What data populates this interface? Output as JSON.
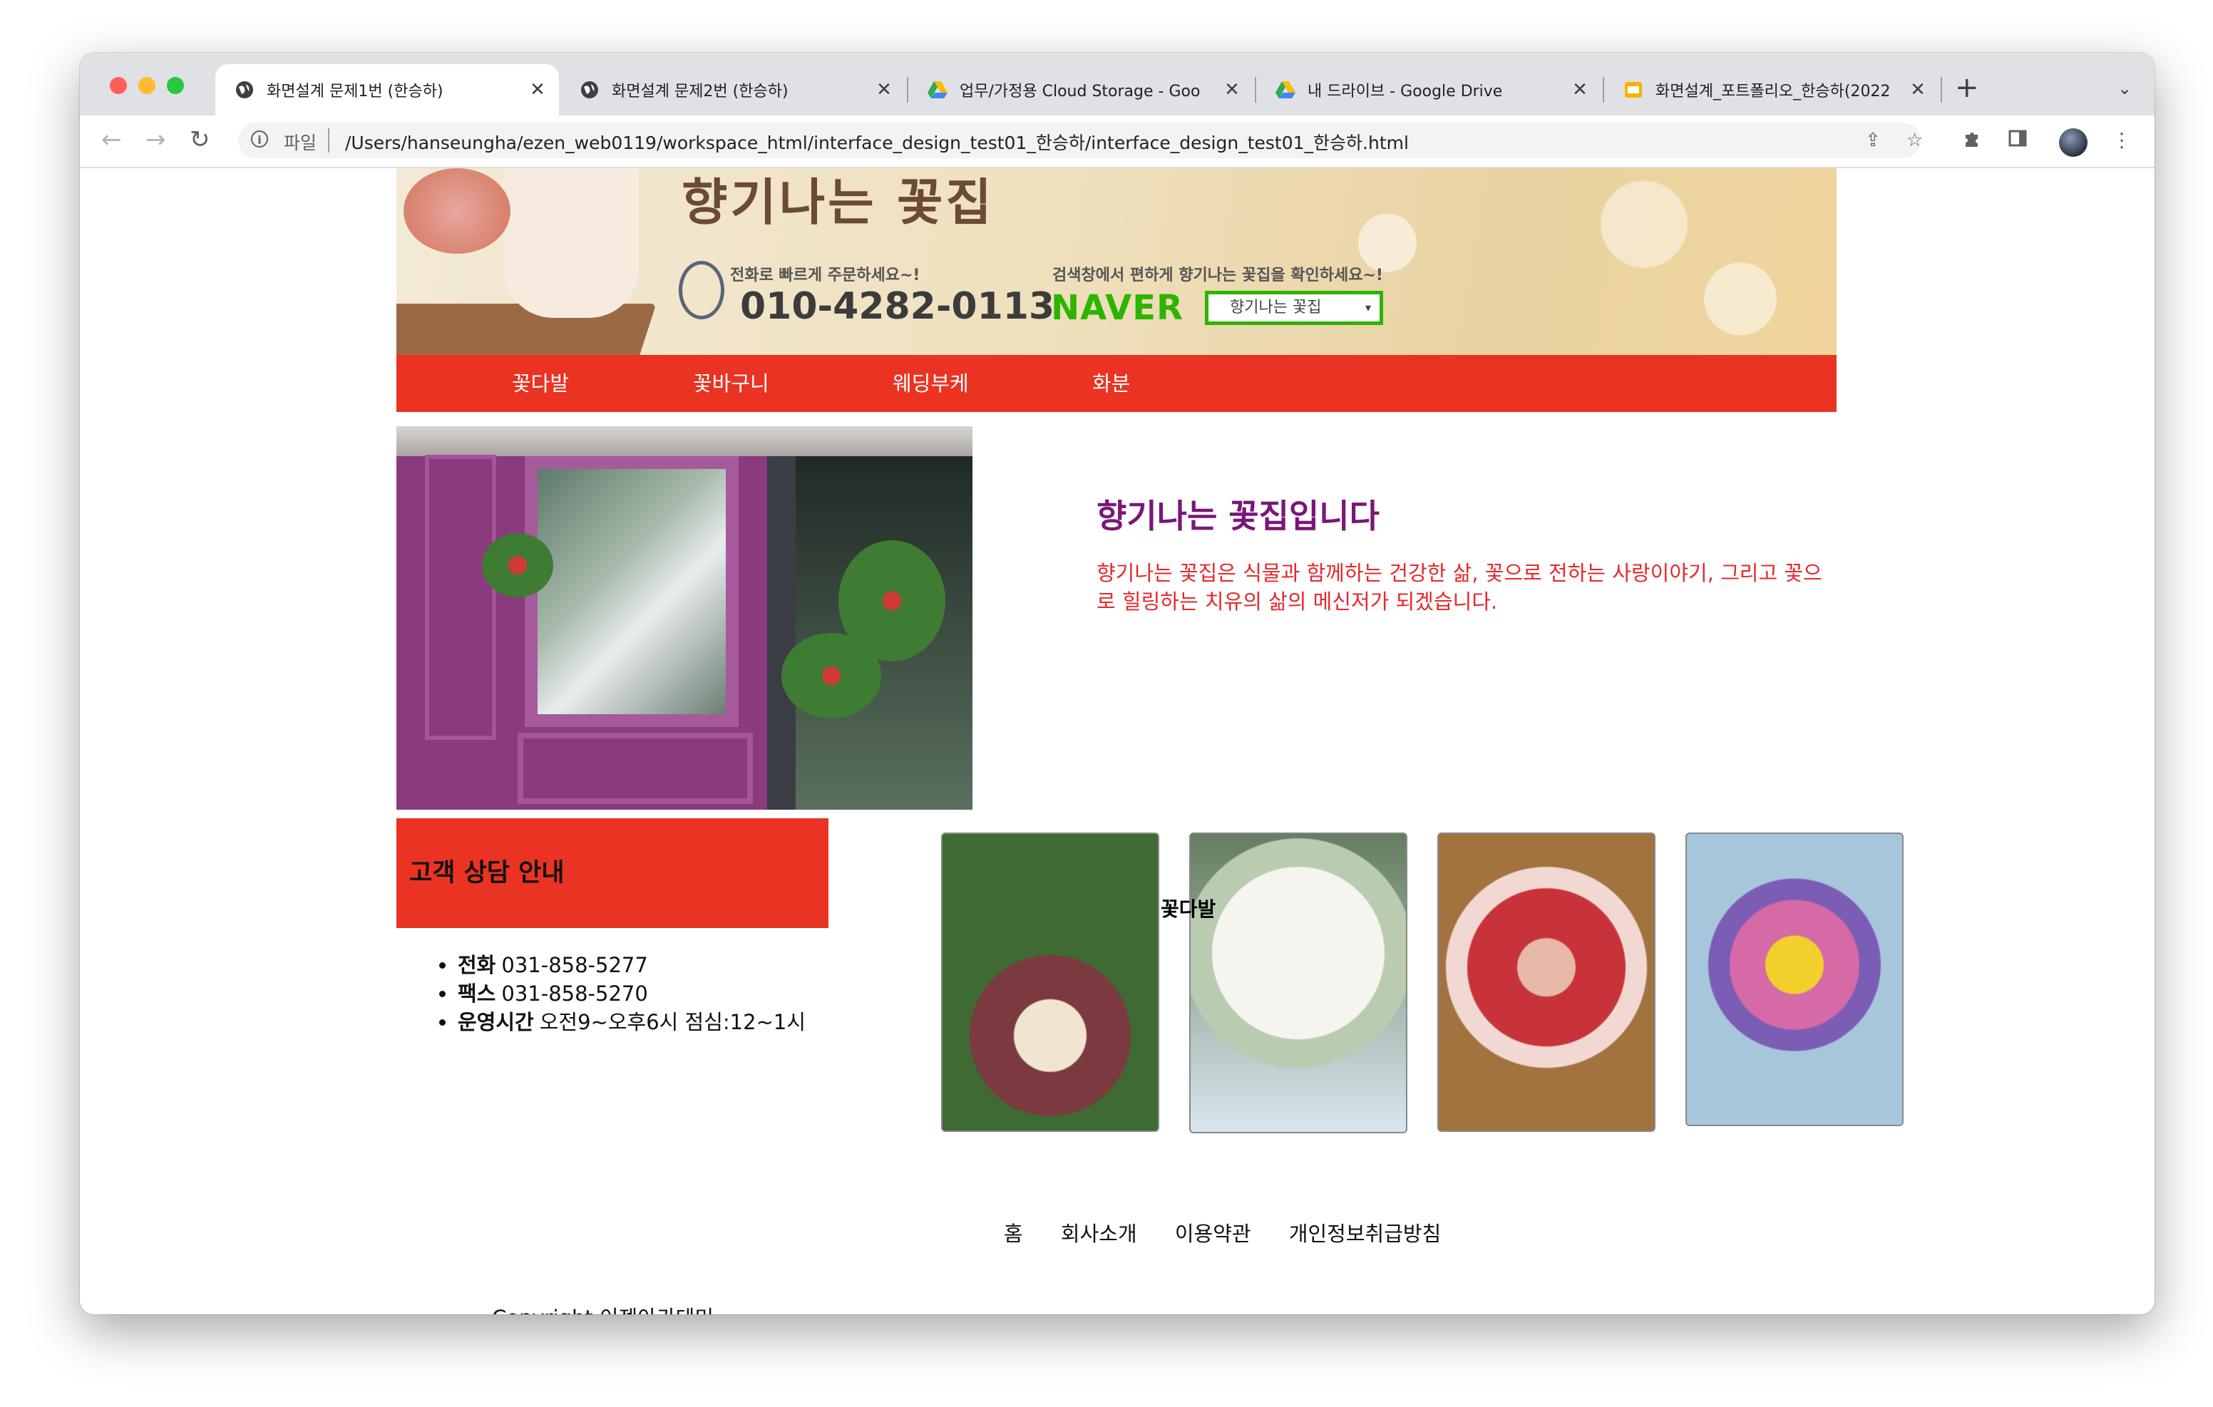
{
  "browser": {
    "tabs": [
      {
        "title": "화면설계 문제1번 (한승하)",
        "icon": "globe-icon"
      },
      {
        "title": "화면설계 문제2번 (한승하)",
        "icon": "globe-icon"
      },
      {
        "title": "업무/가정용 Cloud Storage - Goo",
        "icon": "google-drive-icon"
      },
      {
        "title": "내 드라이브 - Google Drive",
        "icon": "google-drive-icon"
      },
      {
        "title": "화면설계_포트폴리오_한승하(2022",
        "icon": "google-slides-icon"
      }
    ],
    "address": {
      "scheme_label": "파일",
      "url": "/Users/hanseungha/ezen_web0119/workspace_html/interface_design_test01_한승하/interface_design_test01_한승하.html"
    }
  },
  "header": {
    "logo_text": "향기나는 꽃집",
    "order_note": "전화로 빠르게 주문하세요~!",
    "phone": "010-4282-0113",
    "search_note": "검색창에서 편하게 향기나는 꽃집을 확인하세요~!",
    "naver_logo": "NAVER",
    "naver_search": "향기나는 꽃집"
  },
  "nav": {
    "items": [
      "꽃다발",
      "꽃바구니",
      "웨딩부케",
      "화분"
    ]
  },
  "intro": {
    "title": "향기나는 꽃집입니다",
    "text": "향기나는 꽃집은 식물과 함께하는 건강한 삶, 꽃으로 전하는 사랑이야기, 그리고 꽃으로 힐링하는 치유의 삶의 메신저가 되겠습니다."
  },
  "consult": {
    "title": "고객 상담 안내",
    "items": [
      {
        "label": "전화",
        "value": "031-858-5277"
      },
      {
        "label": "팩스",
        "value": "031-858-5270"
      },
      {
        "label": "운영시간",
        "value": "오전9~오후6시 점심:12~1시"
      }
    ]
  },
  "gallery": {
    "overlap_label": "꽃다발"
  },
  "footer": {
    "links": [
      "홈",
      "회사소개",
      "이용약관",
      "개인정보취급방침"
    ],
    "copyright": "Copyright 이젠아카데미"
  },
  "colors": {
    "nav_bg": "#ea3323",
    "intro_title": "#7b1678",
    "intro_text": "#e8272a"
  }
}
